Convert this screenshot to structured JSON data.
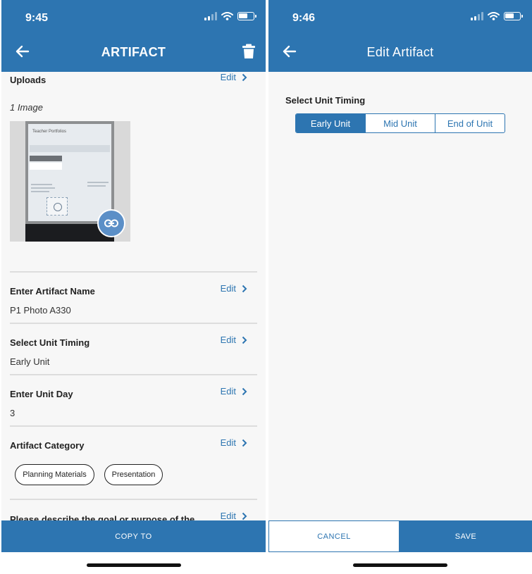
{
  "colors": {
    "accent": "#2d75b1",
    "background": "#f7f7f7",
    "divider": "#dddddd"
  },
  "left_screen": {
    "status_time": "9:45",
    "title": "ARTIFACT",
    "icons": {
      "back": "arrow-left-icon",
      "delete": "trash-icon",
      "link": "link-icon",
      "edit": "chevron-right-icon"
    },
    "uploads": {
      "title": "Uploads",
      "edit": "Edit",
      "count_label": "1 Image",
      "photo_caption": "Teacher Portfolios"
    },
    "sections": [
      {
        "title": "Enter Artifact Name",
        "value": "P1 Photo A330",
        "edit": "Edit"
      },
      {
        "title": "Select Unit Timing",
        "value": "Early Unit",
        "edit": "Edit"
      },
      {
        "title": "Enter Unit Day",
        "value": "3",
        "edit": "Edit"
      }
    ],
    "category": {
      "title": "Artifact Category",
      "edit": "Edit",
      "chips": [
        "Planning Materials",
        "Presentation"
      ]
    },
    "goal": {
      "title": "Please describe the goal or purpose of the",
      "edit": "Edit"
    },
    "copy_button": "COPY TO"
  },
  "right_screen": {
    "status_time": "9:46",
    "title": "Edit Artifact",
    "timing_label": "Select Unit Timing",
    "options": [
      "Early Unit",
      "Mid Unit",
      "End of Unit"
    ],
    "selected_option": "Early Unit",
    "cancel_button": "CANCEL",
    "save_button": "SAVE"
  }
}
